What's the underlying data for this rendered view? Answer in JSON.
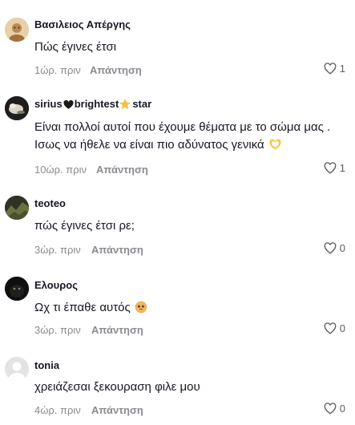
{
  "comments": [
    {
      "username": "Βασιλειος Απέργης",
      "text": "Πώς έγινες έτσι",
      "time": "1ώρ. πριν",
      "reply_label": "Απάντηση",
      "likes": "1"
    },
    {
      "username_parts": [
        "sirius",
        "brightest",
        "star"
      ],
      "text_lines": [
        "Είναι πολλοί αυτοί που έχουμε θέματα με το σώμα μας .",
        "Ισως να ήθελε να είναι πιο αδύνατος γενικά"
      ],
      "time": "10ώρ. πριν",
      "reply_label": "Απάντηση",
      "likes": "1"
    },
    {
      "username": "teoteo",
      "text": "πώς έγινες έτσι ρε;",
      "time": "3ώρ. πριν",
      "reply_label": "Απάντηση",
      "likes": "0"
    },
    {
      "username": "Ελουρος",
      "text": "Ωχ τι έπαθε αυτός",
      "time": "3ώρ. πριν",
      "reply_label": "Απάντηση",
      "likes": "0"
    },
    {
      "username": "tonia",
      "text": "χρειάζεσαι ξεκουραση φιλε μου",
      "time": "4ώρ. πριν",
      "reply_label": "Απάντηση",
      "likes": "0"
    }
  ],
  "icons": {
    "like": "heart-outline-icon",
    "username_heart": "black-heart-emoji",
    "username_star": "star-emoji",
    "heart_hands": "heart-hands-emoji",
    "pleading_face": "pleading-face-emoji"
  },
  "colors": {
    "text": "#161823",
    "meta": "#8a8b91",
    "background": "#ffffff"
  }
}
